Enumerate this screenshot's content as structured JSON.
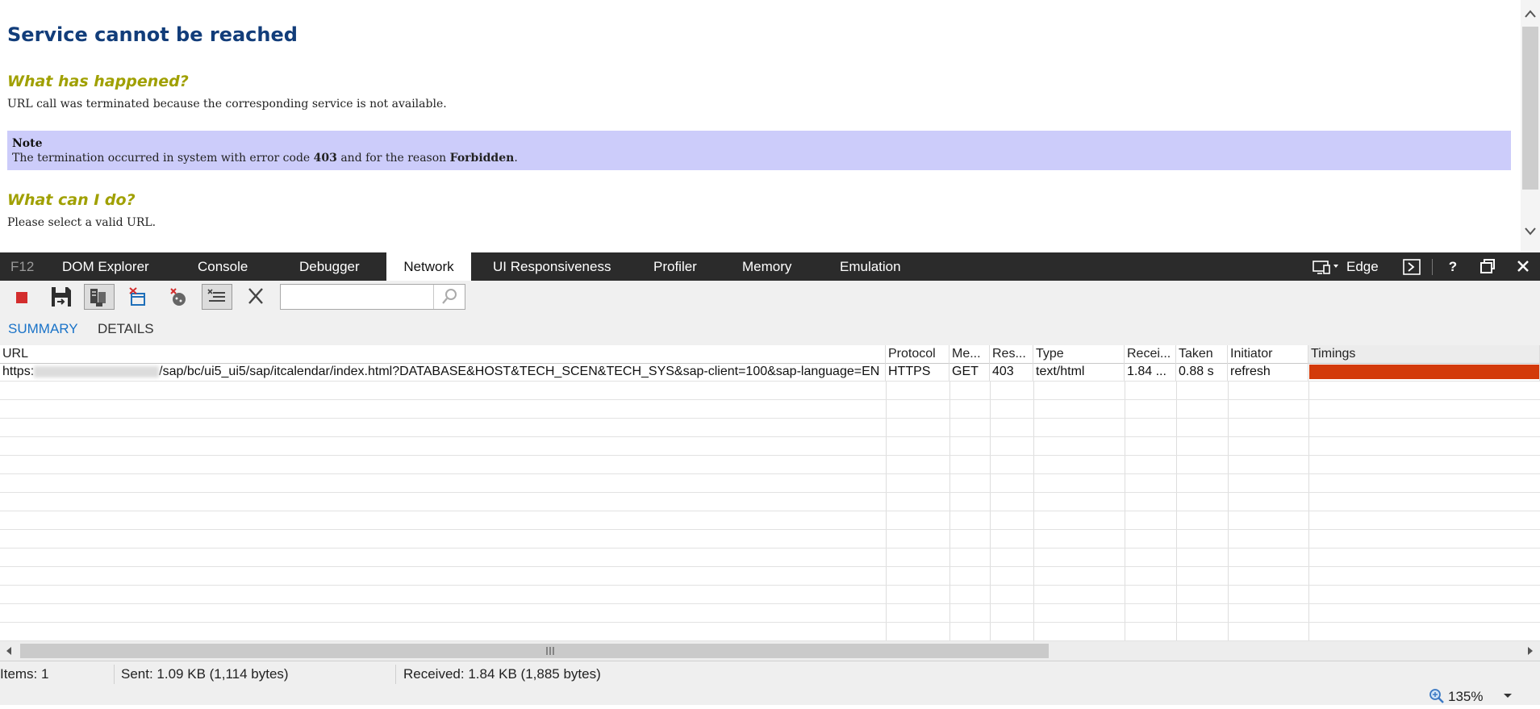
{
  "page": {
    "title": "Service cannot be reached",
    "section1_heading": "What has happened?",
    "section1_text": "URL call was terminated because the corresponding service is not available.",
    "note": {
      "title": "Note",
      "text_prefix": "The termination occurred in system with error code ",
      "error_code": "403",
      "text_middle": " and for the reason ",
      "reason": "Forbidden",
      "text_suffix": "."
    },
    "section2_heading": "What can I do?",
    "section2_text": "Please select a valid URL."
  },
  "devtools": {
    "tabs": [
      {
        "label": "F12"
      },
      {
        "label": "DOM Explorer"
      },
      {
        "label": "Console"
      },
      {
        "label": "Debugger"
      },
      {
        "label": "Network",
        "active": true
      },
      {
        "label": "UI Responsiveness"
      },
      {
        "label": "Profiler"
      },
      {
        "label": "Memory"
      },
      {
        "label": "Emulation"
      }
    ],
    "document_mode": "Edge",
    "subtabs": [
      {
        "label": "SUMMARY",
        "active": true
      },
      {
        "label": "DETAILS"
      }
    ],
    "filter_placeholder": "",
    "columns": [
      "URL",
      "Protocol",
      "Me...",
      "Res...",
      "Type",
      "Recei...",
      "Taken",
      "Initiator",
      "Timings"
    ],
    "requests": [
      {
        "url_scheme": "https:",
        "url_path": "/sap/bc/ui5_ui5/sap/itcalendar/index.html?DATABASE&HOST&TECH_SCEN&TECH_SYS&sap-client=100&sap-language=EN",
        "protocol": "HTTPS",
        "method": "GET",
        "result": "403",
        "type": "text/html",
        "received": "1.84 ...",
        "taken": "0.88 s",
        "initiator": "refresh",
        "timing_color": "#d33a0a"
      }
    ],
    "status": {
      "items": "Items: 1",
      "sent": "Sent: 1.09 KB (1,114 bytes)",
      "received": "Received: 1.84 KB (1,885 bytes)"
    },
    "zoom": "135%"
  }
}
